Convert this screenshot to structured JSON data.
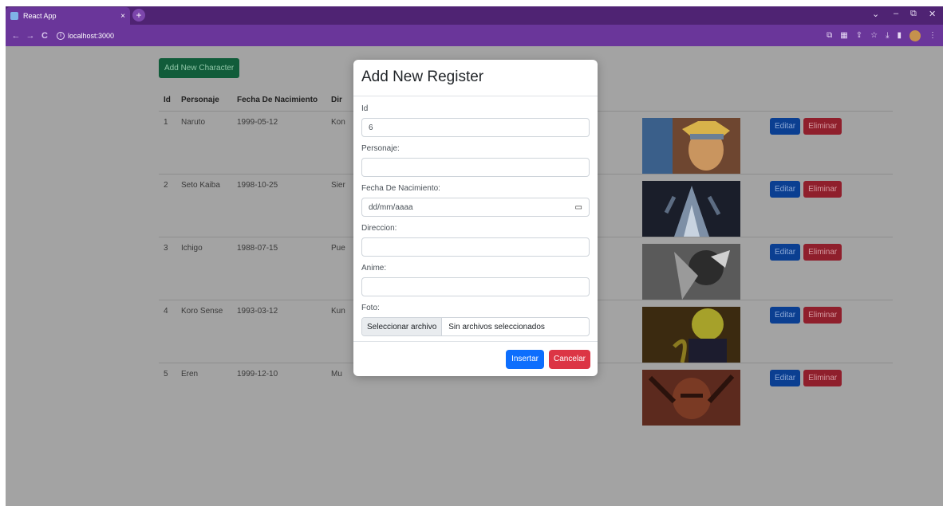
{
  "browser": {
    "tab_title": "React App",
    "tab_close": "×",
    "new_tab": "+",
    "url": "localhost:3000",
    "window_controls": [
      "⌄",
      "–",
      "⧉",
      "✕"
    ],
    "nav": [
      "←",
      "→",
      "C"
    ]
  },
  "page": {
    "add_button": "Add New Character",
    "table": {
      "headers": [
        "Id",
        "Personaje",
        "Fecha De Nacimiento",
        "Dir"
      ],
      "rows": [
        {
          "id": "1",
          "personaje": "Naruto",
          "fecha": "1999-05-12",
          "direccion": "Kon"
        },
        {
          "id": "2",
          "personaje": "Seto Kaiba",
          "fecha": "1998-10-25",
          "direccion": "Sier"
        },
        {
          "id": "3",
          "personaje": "Ichigo",
          "fecha": "1988-07-15",
          "direccion": "Pue"
        },
        {
          "id": "4",
          "personaje": "Koro Sense",
          "fecha": "1993-03-12",
          "direccion": "Kun"
        },
        {
          "id": "5",
          "personaje": "Eren",
          "fecha": "1999-12-10",
          "direccion": "Mu"
        }
      ],
      "edit_label": "Editar",
      "delete_label": "Eliminar"
    }
  },
  "modal": {
    "title": "Add New Register",
    "fields": {
      "id_label": "Id",
      "id_value": "6",
      "personaje_label": "Personaje:",
      "fecha_label": "Fecha De Nacimiento:",
      "fecha_placeholder": "dd/mm/aaaa",
      "direccion_label": "Direccion:",
      "anime_label": "Anime:",
      "foto_label": "Foto:",
      "file_button": "Seleccionar archivo",
      "file_status": "Sin archivos seleccionados"
    },
    "insert_label": "Insertar",
    "cancel_label": "Cancelar"
  },
  "colors": {
    "browser_frame": "#5e2f8a",
    "overlay": "#a3a3a3",
    "primary": "#0d6efd",
    "danger": "#dc3545",
    "success_dimmed": "#115c3a"
  }
}
